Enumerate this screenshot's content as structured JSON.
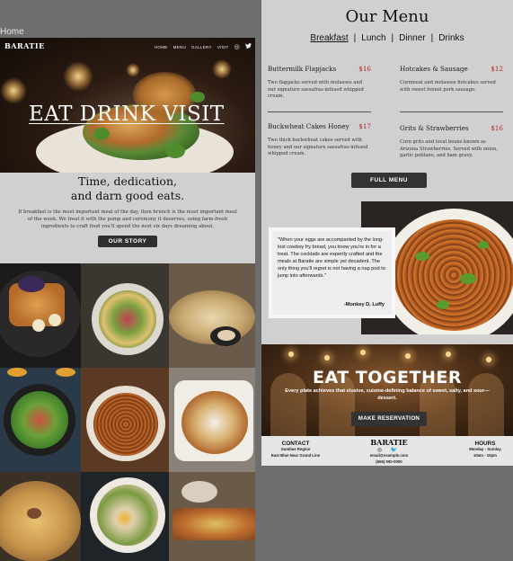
{
  "canvas": {
    "label": "Home"
  },
  "site": {
    "brand": "BARATIE",
    "nav": [
      "HOME",
      "MENU",
      "GALLERY",
      "VISIT"
    ],
    "social_icons": [
      "instagram-icon",
      "twitter-icon"
    ]
  },
  "hero": {
    "title": "EAT  DRINK  VISIT"
  },
  "story": {
    "heading_line1": "Time, dedication,",
    "heading_line2": "and darn good eats.",
    "paragraph": "If breakfast is the most important meal of the day, then brunch is the most important meal of the week. We treat it with the pomp and ceremony it deserves, using farm-fresh ingredients to craft food you'll spend the next six days dreaming about.",
    "button": "OUR STORY"
  },
  "menu": {
    "title": "Our Menu",
    "tabs": [
      "Breakfast",
      "|",
      "Lunch",
      "|",
      "Dinner",
      "|",
      "Drinks"
    ],
    "active_tab": "Breakfast",
    "items": [
      {
        "name": "Buttermilk Flapjacks",
        "price": "$16",
        "desc": "Two flapjacks served with molasses and our signature sassafras-infused whipped cream."
      },
      {
        "name": "Hotcakes & Sausage",
        "price": "$12",
        "desc": "Cornmeal and molasses hotcakes served with sweet fennel pork sausage."
      },
      {
        "name": "Buckwheat Cakes Honey",
        "price": "$17",
        "desc": "Two thick buckwheat cakes served with honey and our signature sassafras-infused whipped cream."
      },
      {
        "name": "Grits & Strawberries",
        "price": "$16",
        "desc": "Corn grits and local beans known as Arizona Strawberries. Served with onion, garlic poblano, and ham gravy."
      }
    ],
    "button": "FULL MENU",
    "accent": "#b02828"
  },
  "quote": {
    "text": "\"When your eggs are accompanied by the long-lost cowboy fry bread, you know you're in for a treat. The cocktails are expertly crafted and the meals at Baratie are simple yet decadent. The only thing you'll regret is not having a nap pod to jump into afterwards.\"",
    "author": "-Monkey D. Luffy"
  },
  "eat_together": {
    "title": "EAT TOGETHER",
    "subtitle": "Every plate achieves that elusive, cuisine-defining balance of sweet, salty, and sour—dessert.",
    "button": "MAKE RESERVATION"
  },
  "footer": {
    "contact_heading": "CONTACT",
    "contact_line1": "Gambas Region",
    "contact_line2": "East Blue Near Grand Line",
    "brand": "BARATIE",
    "social": "◎ 🐦",
    "email": "email@example.com",
    "phone": "(555) 000-0000",
    "hours_heading": "HOURS",
    "hours_line1": "Monday - Sunday",
    "hours_line2": "10am - 10pm"
  }
}
